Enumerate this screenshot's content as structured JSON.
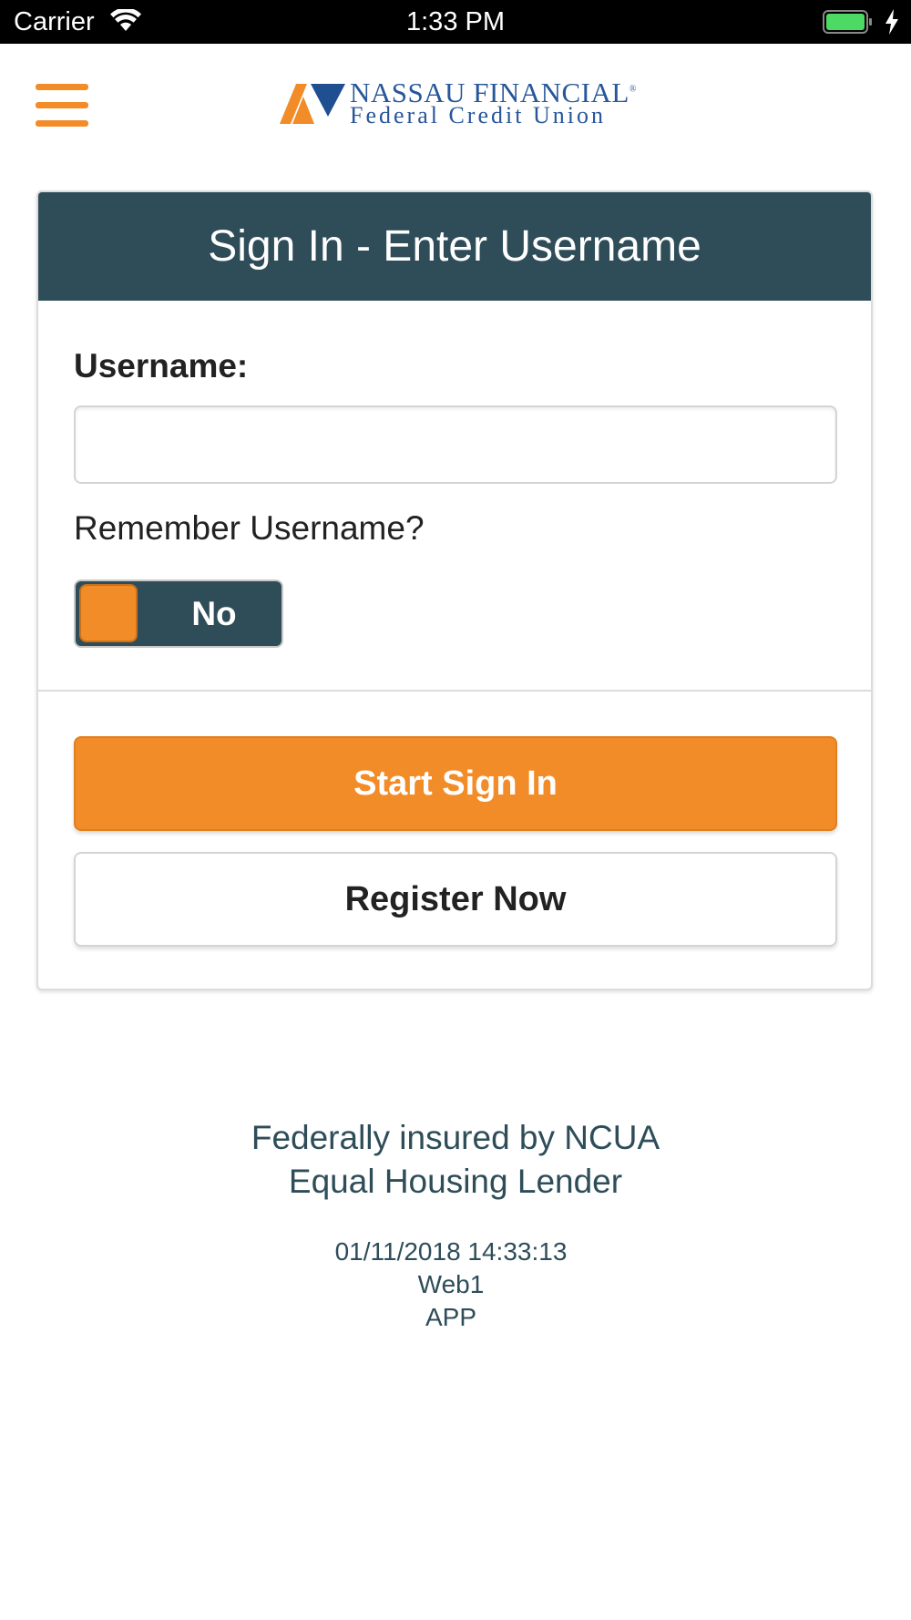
{
  "status_bar": {
    "carrier": "Carrier",
    "time": "1:33 PM"
  },
  "header": {
    "logo_name": "NASSAU FINANCIAL",
    "logo_registered": "®",
    "logo_sub": "Federal Credit Union"
  },
  "card": {
    "title": "Sign In - Enter Username",
    "username_label": "Username:",
    "username_value": "",
    "remember_label": "Remember Username?",
    "remember_toggle": "No",
    "start_button": "Start Sign In",
    "register_button": "Register Now"
  },
  "footer": {
    "line1": "Federally insured by NCUA",
    "line2": "Equal Housing Lender",
    "timestamp": "01/11/2018 14:33:13",
    "server": "Web1",
    "app": "APP"
  },
  "colors": {
    "accent": "#f28c28",
    "header_bg": "#2e4d59",
    "logo_blue": "#27569a"
  },
  "icons": [
    "wifi-icon",
    "battery-icon",
    "charging-bolt-icon",
    "menu-icon"
  ]
}
